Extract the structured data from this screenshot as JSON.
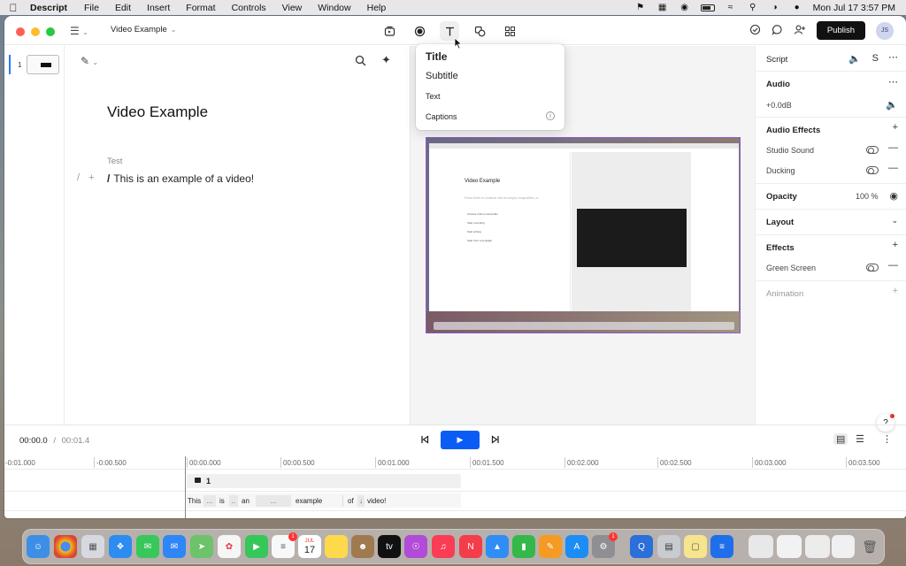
{
  "menubar": {
    "app_name": "Descript",
    "items": [
      "File",
      "Edit",
      "Insert",
      "Format",
      "Controls",
      "View",
      "Window",
      "Help"
    ],
    "clock": "Mon Jul 17  3:57 PM"
  },
  "titlebar": {
    "project_name": "Video Example",
    "publish_label": "Publish",
    "avatar_initials": "JS",
    "icons": [
      "publish-scene-icon",
      "record-icon",
      "text-icon",
      "shapes-icon",
      "grid-icon"
    ]
  },
  "thumbnails": {
    "scene_number": "1"
  },
  "editor": {
    "title": "Video Example",
    "speaker": "Test",
    "line_slash": "/",
    "line_text": "This is an example of a video!"
  },
  "text_menu": {
    "title": "Title",
    "subtitle": "Subtitle",
    "text": "Text",
    "captions": "Captions"
  },
  "preview": {
    "title": "Video Example",
    "subtitle": "Press Enter to continue with an empty composition, or",
    "items": [
      "Choose a file to transcribe",
      "Start recording",
      "Start writing",
      "Start from a template"
    ]
  },
  "panel": {
    "script_label": "Script",
    "script_speaker_letter": "S",
    "audio_label": "Audio",
    "audio_gain": "+0.0dB",
    "audio_effects_label": "Audio Effects",
    "studio_sound_label": "Studio Sound",
    "ducking_label": "Ducking",
    "opacity_label": "Opacity",
    "opacity_value": "100 %",
    "layout_label": "Layout",
    "effects_label": "Effects",
    "green_screen_label": "Green Screen",
    "animation_label": "Animation",
    "help_label": "?"
  },
  "transport": {
    "current_time": "00:00.0",
    "separator": "/",
    "duration": "00:01.4"
  },
  "timeline": {
    "ticks": [
      "-0:01.000",
      "-0:00.500",
      "00:00.000",
      "00:00.500",
      "00:01.000",
      "00:01.500",
      "00:02.000",
      "00:02.500",
      "00:03.000",
      "00:03.500"
    ],
    "clip_label": "1",
    "words": [
      "This",
      "...",
      "is",
      "..",
      "an",
      "...",
      "example",
      "of",
      "↓",
      "video!"
    ]
  },
  "dock": {
    "calendar_month": "JUL",
    "calendar_day": "17",
    "reminders_badge": "1",
    "settings_badge": "1",
    "tv_label": "tv"
  }
}
